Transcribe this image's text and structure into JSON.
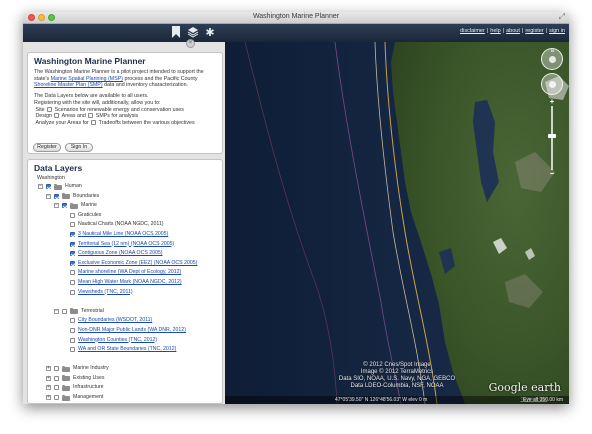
{
  "window": {
    "title": "Washington Marine Planner"
  },
  "toolbar": {
    "icons": [
      "bookmark-icon",
      "layers-icon",
      "gear-icon"
    ],
    "links": [
      "disclaimer",
      "help",
      "about",
      "register",
      "sign in"
    ]
  },
  "intro": {
    "title": "Washington Marine Planner",
    "p1_a": "The Washington Marine Planner is a pilot project intended to support the state's ",
    "p1_link1": "Marine Spatial Planning (MSP)",
    "p1_b": " process and the Pacific County ",
    "p1_link2": "Shoreline Master Plan (SMP)",
    "p1_c": " data and inventory characterization.",
    "p2": "The Data Layers below are available to all users.",
    "p3": "Registering with the site will, additionally, allow you to:",
    "f1_a": "Site",
    "f1_b": "Scenarios for renewable energy and conservation uses",
    "f2_a": "Design",
    "f2_b": "Areas and",
    "f2_c": "SMPs for analysis",
    "f3_a": "Analyze your Areas for",
    "f3_b": "Tradeoffs between the various objectives",
    "register_label": "Register",
    "signin_label": "Sign In"
  },
  "layers": {
    "title": "Data Layers",
    "root": "Washington",
    "rows": [
      {
        "label": "Human",
        "checked": true,
        "level": 0,
        "expander": "−"
      },
      {
        "label": "Boundaries",
        "checked": true,
        "level": 1,
        "expander": "−"
      },
      {
        "label": "Marine",
        "checked": true,
        "level": 2,
        "expander": "−"
      },
      {
        "label": "Graticules",
        "checked": false,
        "level": 3,
        "link": false
      },
      {
        "label": "Nautical Charts (NOAA NGDC, 2011)",
        "checked": false,
        "level": 3,
        "link": false
      },
      {
        "label": "3 Nautical Mile Line (NOAA OCS 2005)",
        "checked": true,
        "level": 3,
        "link": true
      },
      {
        "label": "Territorial Sea (12 nm) (NOAA OCS 2005)",
        "checked": true,
        "level": 3,
        "link": true
      },
      {
        "label": "Contiguous Zone (NOAA OCS 2005)",
        "checked": true,
        "level": 3,
        "link": true
      },
      {
        "label": "Exclusive Economic Zone (EEZ) (NOAA OCS 2005)",
        "checked": true,
        "level": 3,
        "link": true
      },
      {
        "label": "Marine shoreline (WA Dept of Ecology, 2012)",
        "checked": false,
        "level": 3,
        "link": true
      },
      {
        "label": "Mean High Water Mark (NOAA NGDC, 2012)",
        "checked": false,
        "level": 3,
        "link": true
      },
      {
        "label": "Viewsheds (TNC, 2011)",
        "checked": false,
        "level": 3,
        "link": true
      },
      {
        "label": "",
        "checked": null,
        "level": 3,
        "link": false
      },
      {
        "label": "Terrestrial",
        "checked": false,
        "level": 2,
        "expander": "−"
      },
      {
        "label": "City Boundaries (WSDOT, 2011)",
        "checked": false,
        "level": 3,
        "link": true
      },
      {
        "label": "Non-DNR Major Public Lands (WA DNR, 2012)",
        "checked": false,
        "level": 3,
        "link": true
      },
      {
        "label": "Washington Counties (TNC, 2012)",
        "checked": false,
        "level": 3,
        "link": true
      },
      {
        "label": "WA and OR State Boundaries (TNC, 2012)",
        "checked": false,
        "level": 3,
        "link": true
      },
      {
        "label": "",
        "checked": null,
        "level": 3,
        "link": false
      },
      {
        "label": "Marine Industry",
        "checked": false,
        "level": 1,
        "expander": "+"
      },
      {
        "label": "Existing Uses",
        "checked": false,
        "level": 1,
        "expander": "+"
      },
      {
        "label": "Infrastructure",
        "checked": false,
        "level": 1,
        "expander": "+"
      },
      {
        "label": "Management",
        "checked": false,
        "level": 1,
        "expander": "+"
      }
    ]
  },
  "map": {
    "attribution": [
      "© 2012 Cnes/Spot Image",
      "Image © 2012 TerraMetrics",
      "Data SIO, NOAA, U.S. Navy, NGA, GEBCO",
      "Data LDEO-Columbia, NSF, NOAA"
    ],
    "logo": "Google earth",
    "terms": "Terms of Use",
    "coords": "47°05'39.50\" N 126°48'56.03\" W  elev   0 m",
    "eye_alt": "Eye alt   350.00 km",
    "colors": {
      "ocean": "#13233e",
      "land": "#3d5a2a",
      "line1": "#c9a24a",
      "line2": "#c8b7a0",
      "line3": "#7a4a8a"
    }
  }
}
